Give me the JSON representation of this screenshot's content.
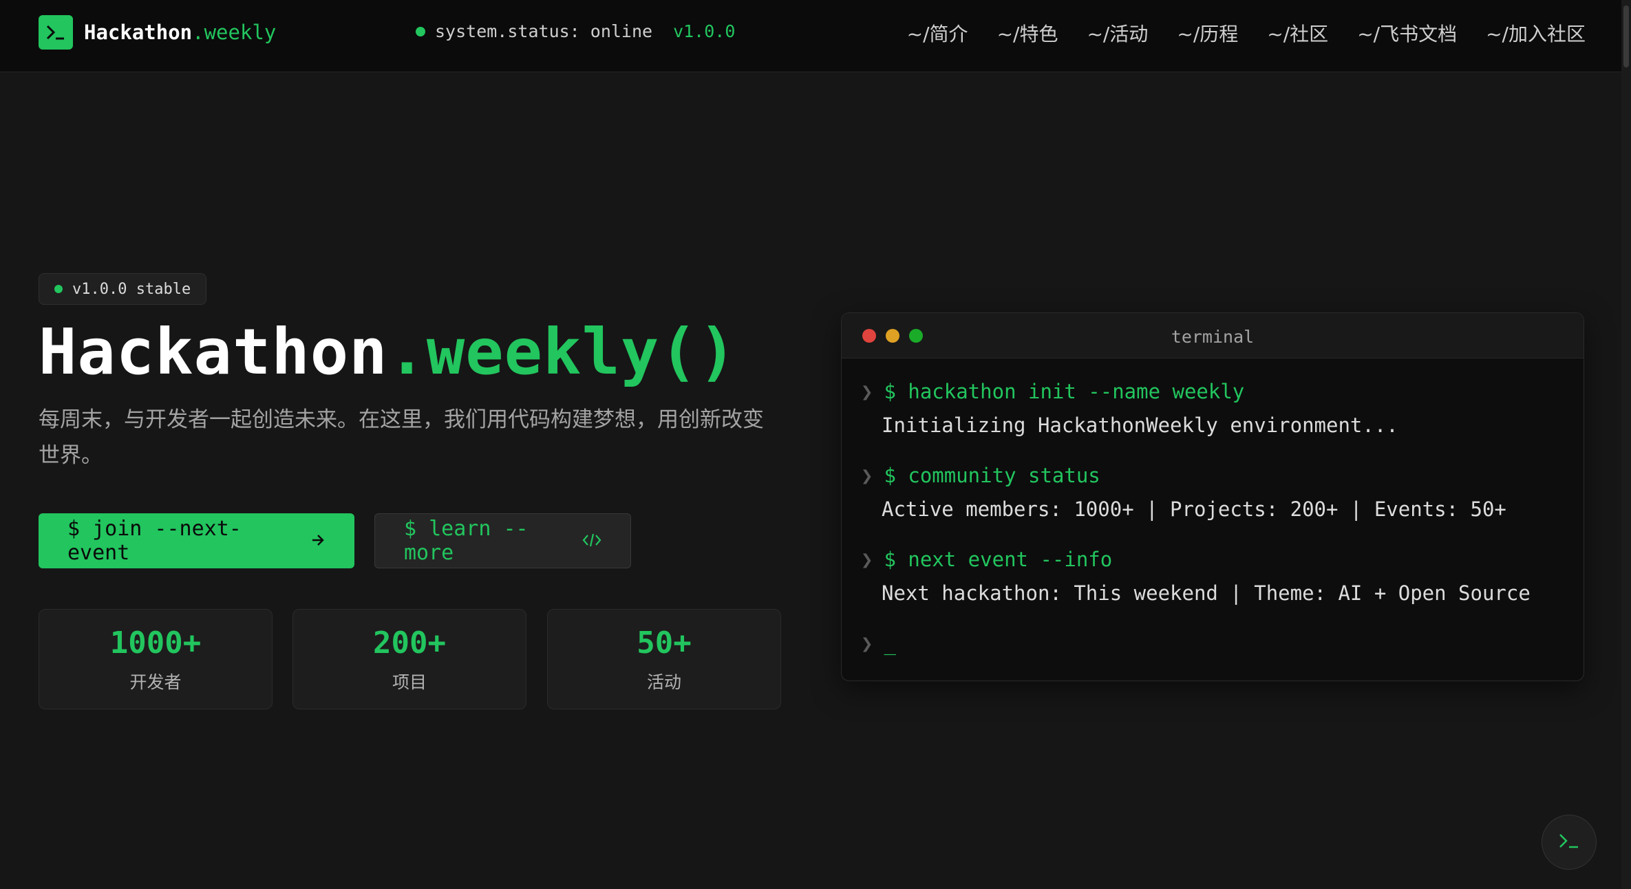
{
  "header": {
    "brand_main": "Hackathon",
    "brand_accent": ".weekly",
    "status_text": "system.status: online",
    "version": "v1.0.0",
    "nav": [
      "~/简介",
      "~/特色",
      "~/活动",
      "~/历程",
      "~/社区",
      "~/飞书文档",
      "~/加入社区"
    ]
  },
  "hero": {
    "badge": "v1.0.0 stable",
    "title_main": "Hackathon",
    "title_accent": ".weekly()",
    "description": "每周末，与开发者一起创造未来。在这里，我们用代码构建梦想，用创新改变世界。",
    "primary_button": "$ join --next-event",
    "secondary_button": "$ learn --more",
    "stats": [
      {
        "value": "1000+",
        "label": "开发者"
      },
      {
        "value": "200+",
        "label": "项目"
      },
      {
        "value": "50+",
        "label": "活动"
      }
    ]
  },
  "terminal": {
    "title": "terminal",
    "prompt_symbol": "❯",
    "lines": [
      {
        "cmd": "$ hackathon init --name weekly",
        "out": "Initializing HackathonWeekly environment..."
      },
      {
        "cmd": "$ community status",
        "out": "Active members: 1000+ | Projects: 200+ | Events: 50+"
      },
      {
        "cmd": "$ next event --info",
        "out": "Next hackathon: This weekend | Theme: AI + Open Source"
      }
    ],
    "cursor": "_"
  },
  "colors": {
    "accent": "#22c55e",
    "background": "#161616",
    "traffic_red": "#e0443e",
    "traffic_yellow": "#dea123",
    "traffic_green": "#1aab29"
  },
  "icons": [
    "terminal-icon",
    "arrow-right-icon",
    "code-icon"
  ]
}
